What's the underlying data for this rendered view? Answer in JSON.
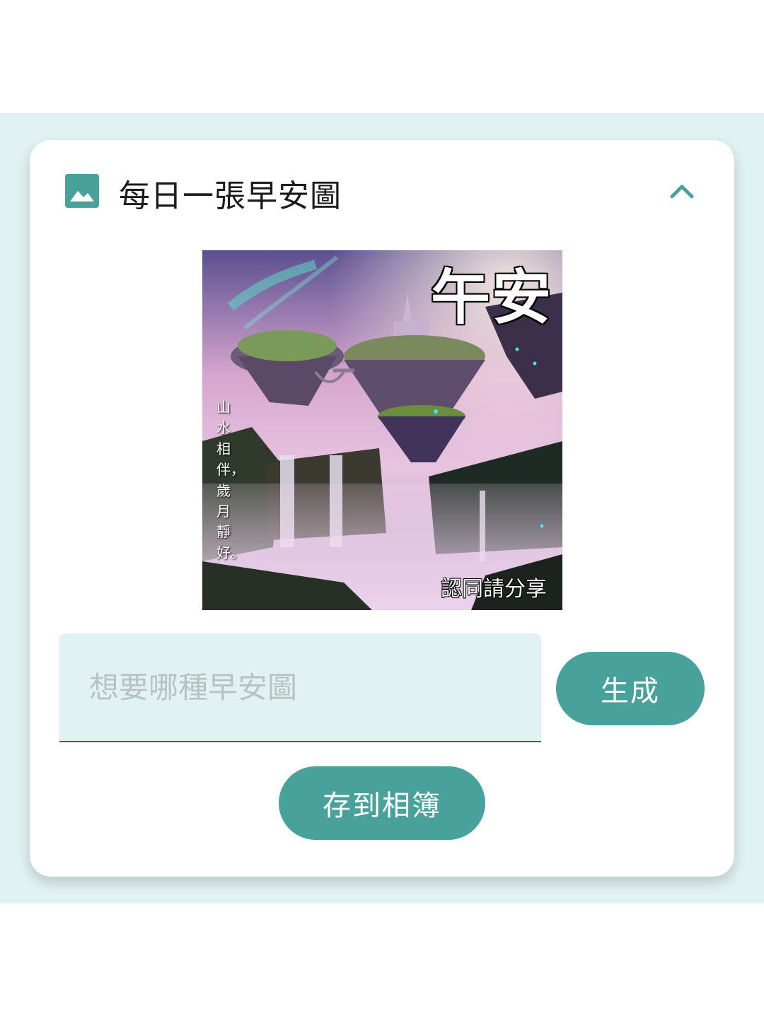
{
  "card": {
    "title": "每日一張早安圖",
    "icon": "image-icon",
    "collapse_icon": "chevron-up-icon"
  },
  "artwork": {
    "title_text": "午安",
    "verse_text": "山水相伴，歲月靜好。",
    "share_text": "認同請分享",
    "description_icon": "fantasy-floating-islands-image"
  },
  "prompt": {
    "value": "",
    "placeholder": "想要哪種早安圖"
  },
  "buttons": {
    "generate_label": "生成",
    "save_label": "存到相簿"
  },
  "colors": {
    "accent": "#48a19b",
    "band_background": "#e1f2f2",
    "card_background": "#ffffff"
  }
}
